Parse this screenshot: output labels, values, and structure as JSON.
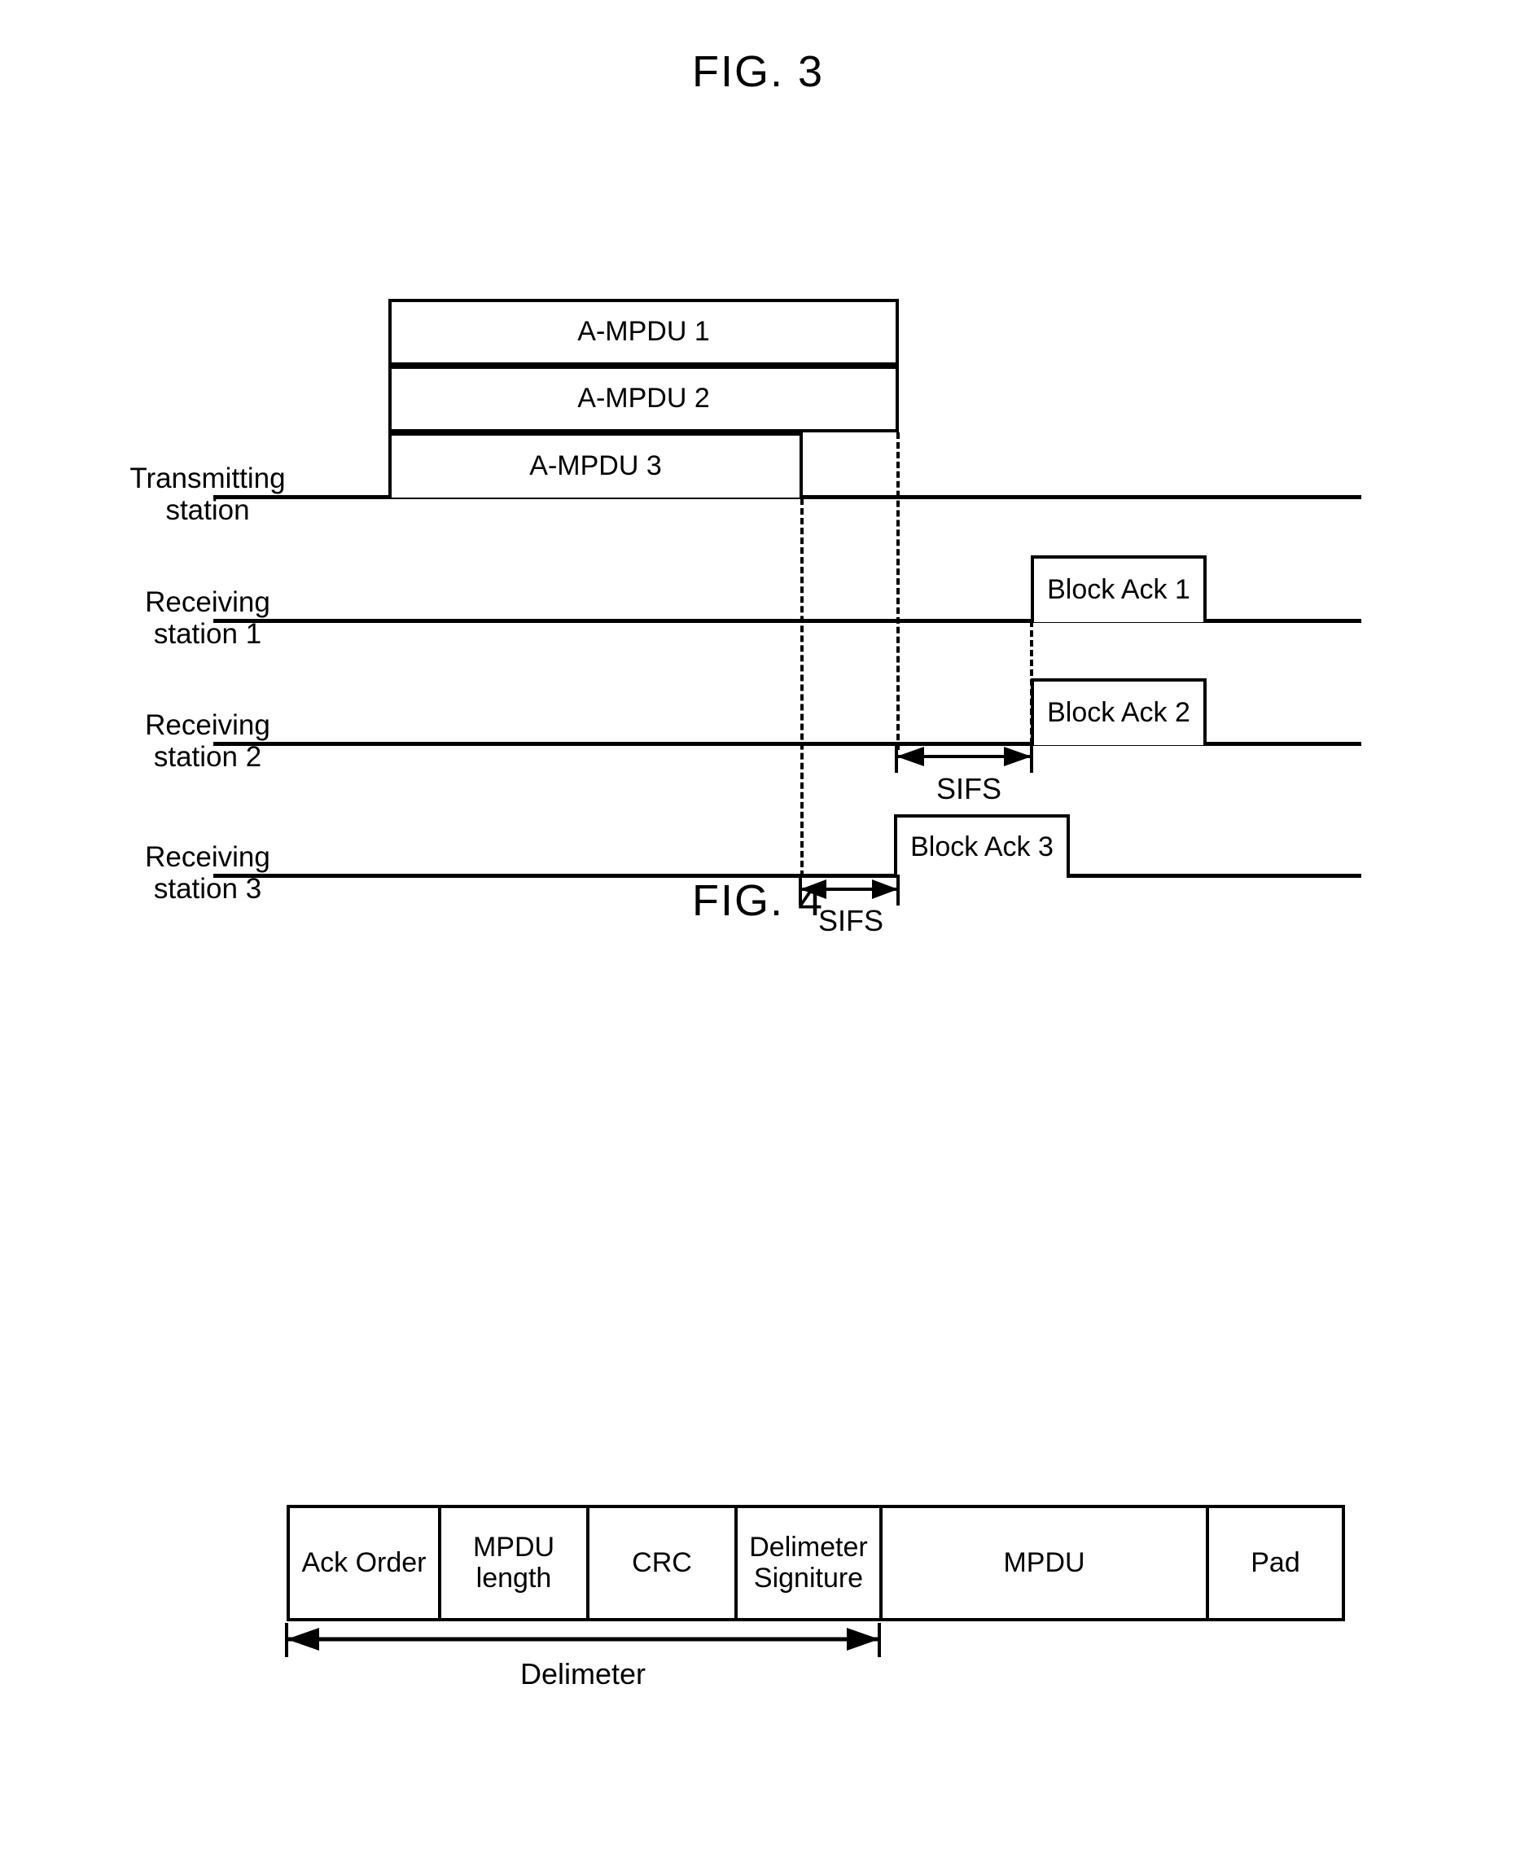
{
  "figures": {
    "fig3": {
      "title": "FIG. 3",
      "stations": [
        {
          "line1": "Transmitting",
          "line2": "station"
        },
        {
          "line1": "Receiving",
          "line2": "station 1"
        },
        {
          "line1": "Receiving",
          "line2": "station 2"
        },
        {
          "line1": "Receiving",
          "line2": "station 3"
        }
      ],
      "ampdu_blocks": [
        {
          "label": "A-MPDU 1"
        },
        {
          "label": "A-MPDU 2"
        },
        {
          "label": "A-MPDU 3"
        }
      ],
      "block_acks": [
        {
          "label": "Block Ack 1"
        },
        {
          "label": "Block Ack 2"
        },
        {
          "label": "Block Ack 3"
        }
      ],
      "interval_labels": [
        {
          "label": "SIFS"
        },
        {
          "label": "SIFS"
        }
      ]
    },
    "fig4": {
      "title": "FIG. 4",
      "fields": [
        {
          "label": "Ack Order"
        },
        {
          "label": "MPDU\nlength"
        },
        {
          "label": "CRC"
        },
        {
          "label": "Delimeter\nSigniture"
        },
        {
          "label": "MPDU"
        },
        {
          "label": "Pad"
        }
      ],
      "span_label": "Delimeter"
    }
  },
  "colors": {
    "ink": "#000000",
    "paper": "#ffffff"
  }
}
